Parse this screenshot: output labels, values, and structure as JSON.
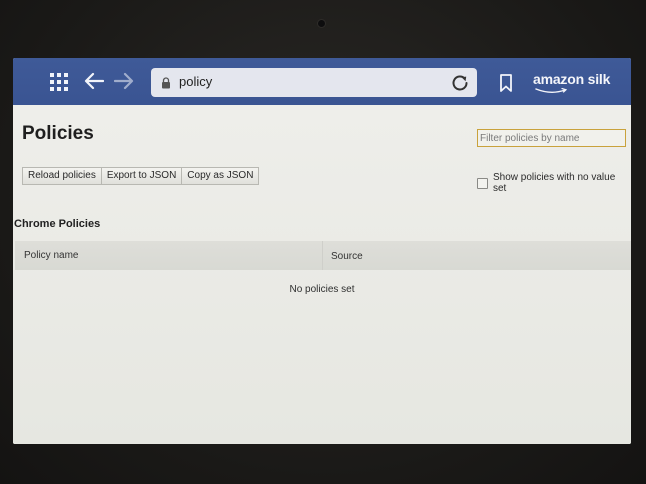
{
  "toolbar": {
    "url": "policy",
    "brand": "amazon silk",
    "icons": {
      "apps": "apps-grid-icon",
      "back": "arrow-left-icon",
      "forward": "arrow-right-icon",
      "lock": "lock-icon",
      "reload": "reload-icon",
      "bookmark": "bookmark-icon"
    },
    "color": "#3d5796"
  },
  "page": {
    "title": "Policies",
    "filter_placeholder": "Filter policies by name",
    "buttons": {
      "reload": "Reload policies",
      "export": "Export to JSON",
      "copy": "Copy as JSON"
    },
    "show_unset_label": "Show policies with no value set",
    "show_unset_checked": false,
    "section_title": "Chrome Policies",
    "table": {
      "columns": [
        "Policy name",
        "Source"
      ],
      "empty_message": "No policies set"
    },
    "filter_border_color": "#c9a23c"
  }
}
